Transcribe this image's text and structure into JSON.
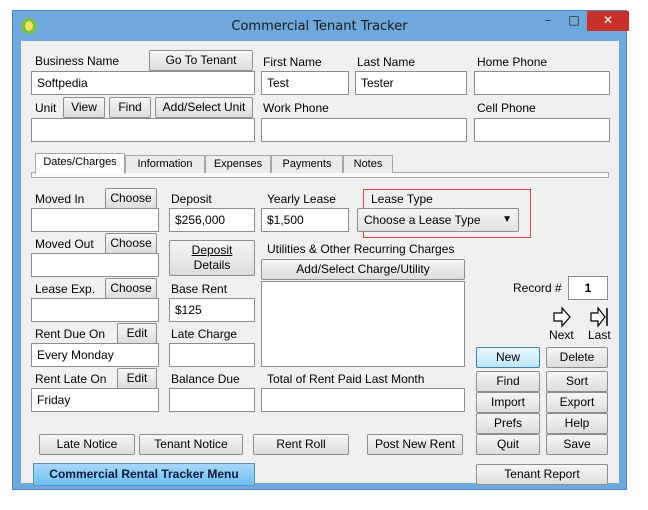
{
  "window": {
    "title": "Commercial Tenant Tracker",
    "min_label": "–",
    "max_label": "□",
    "close_label": "✕"
  },
  "business": {
    "label": "Business Name",
    "value": "Softpedia",
    "goto_label": "Go To Tenant"
  },
  "unit": {
    "label": "Unit",
    "view_label": "View",
    "find_label": "Find",
    "add_label": "Add/Select Unit",
    "value": ""
  },
  "first_name": {
    "label": "First Name",
    "value": "Test"
  },
  "last_name": {
    "label": "Last Name",
    "value": "Tester"
  },
  "home_phone": {
    "label": "Home Phone",
    "value": ""
  },
  "work_phone": {
    "label": "Work Phone",
    "value": ""
  },
  "cell_phone": {
    "label": "Cell Phone",
    "value": ""
  },
  "tabs": [
    {
      "label": "Dates/Charges",
      "active": true
    },
    {
      "label": "Information",
      "active": false
    },
    {
      "label": "Expenses",
      "active": false
    },
    {
      "label": "Payments",
      "active": false
    },
    {
      "label": "Notes",
      "active": false
    }
  ],
  "moved_in": {
    "label": "Moved In",
    "choose_label": "Choose",
    "value": ""
  },
  "moved_out": {
    "label": "Moved Out",
    "choose_label": "Choose",
    "value": ""
  },
  "lease_exp": {
    "label": "Lease Exp.",
    "choose_label": "Choose",
    "value": ""
  },
  "rent_due_on": {
    "label": "Rent Due On",
    "edit_label": "Edit",
    "value": "Every Monday"
  },
  "rent_late_on": {
    "label": "Rent Late On",
    "edit_label": "Edit",
    "value": "Friday"
  },
  "deposit": {
    "label": "Deposit",
    "value": "$256,000",
    "details_line1": "Deposit",
    "details_line2": "Details"
  },
  "yearly_lease": {
    "label": "Yearly Lease",
    "value": "$1,500"
  },
  "lease_type": {
    "label": "Lease Type",
    "selected": "Choose a Lease Type"
  },
  "base_rent": {
    "label": "Base Rent",
    "value": "$125"
  },
  "late_charge": {
    "label": "Late Charge",
    "value": ""
  },
  "balance_due": {
    "label": "Balance Due",
    "value": ""
  },
  "utilities": {
    "label": "Utilities & Other Recurring Charges",
    "add_label": "Add/Select Charge/Utility"
  },
  "total_rent": {
    "label": "Total of Rent Paid Last Month",
    "value": ""
  },
  "record": {
    "label": "Record #",
    "value": "1",
    "next_label": "Next",
    "last_label": "Last"
  },
  "actions": {
    "new": "New",
    "delete": "Delete",
    "find": "Find",
    "sort": "Sort",
    "import": "Import",
    "export": "Export",
    "prefs": "Prefs",
    "help": "Help",
    "quit": "Quit",
    "save": "Save",
    "tenant_report": "Tenant Report"
  },
  "bottom": {
    "late_notice": "Late Notice",
    "tenant_notice": "Tenant Notice",
    "rent_roll": "Rent Roll",
    "post_new_rent": "Post New Rent",
    "menu": "Commercial Rental Tracker Menu"
  }
}
